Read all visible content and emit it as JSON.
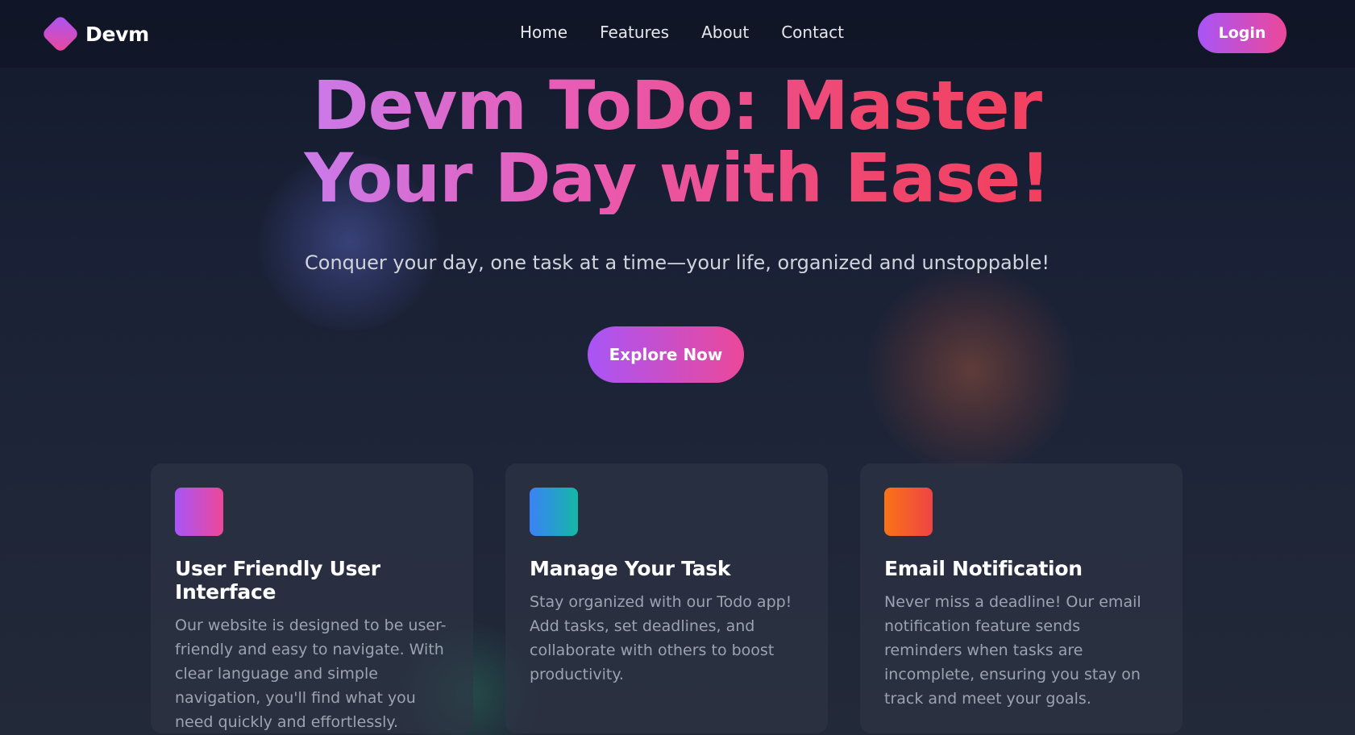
{
  "brand": {
    "name": "Devm",
    "logo_icon": "diamond-logo-icon"
  },
  "nav": {
    "links": [
      "Home",
      "Features",
      "About",
      "Contact"
    ],
    "login_label": "Login"
  },
  "hero": {
    "title_line1": "Devm ToDo: Master",
    "title_line2": "Your Day with Ease!",
    "subtitle": "Conquer your day, one task at a time—your life, organized and unstoppable!",
    "cta_label": "Explore Now"
  },
  "features": [
    {
      "icon": "gradient-square-icon",
      "icon_colors": [
        "#a855f7",
        "#ec4899"
      ],
      "title": "User Friendly User Interface",
      "text": "Our website is designed to be user-friendly and easy to navigate. With clear language and simple navigation, you'll find what you need quickly and effortlessly."
    },
    {
      "icon": "gradient-square-icon",
      "icon_colors": [
        "#3b82f6",
        "#14b8a6"
      ],
      "title": "Manage Your Task",
      "text": "Stay organized with our Todo app! Add tasks, set deadlines, and collaborate with others to boost productivity."
    },
    {
      "icon": "gradient-square-icon",
      "icon_colors": [
        "#f97316",
        "#ef4444"
      ],
      "title": "Email Notification",
      "text": "Never miss a deadline! Our email notification feature sends reminders when tasks are incomplete, ensuring you stay on track and meet your goals."
    }
  ],
  "colors": {
    "background": "#1a2136",
    "accent_start": "#a855f7",
    "accent_end": "#ec4899",
    "title_end": "#f43f5e",
    "card_bg": "#2e3546",
    "muted_text": "#9ca3af"
  }
}
